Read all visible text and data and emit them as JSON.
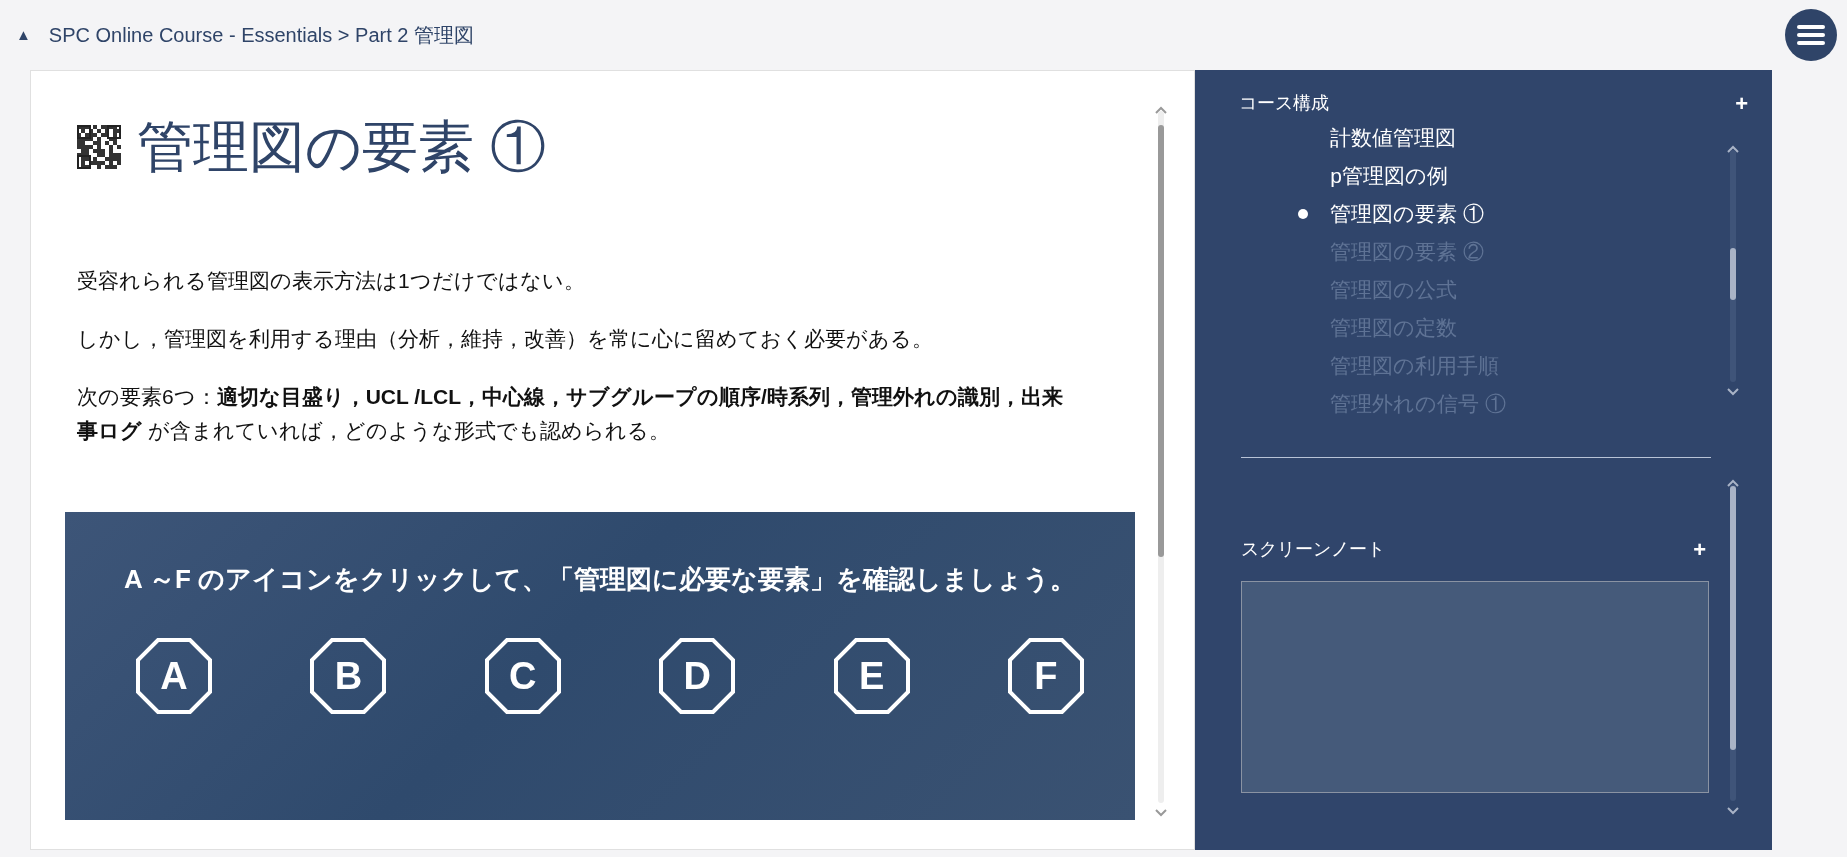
{
  "breadcrumb": {
    "toggle": "▲",
    "path": "SPC Online Course - Essentials > Part 2 管理図"
  },
  "page": {
    "title": "管理図の要素 ①",
    "paragraphs": [
      "受容れられる管理図の表示方法は1つだけではない。",
      "しかし，管理図を利用する理由（分析，維持，改善）を常に心に留めておく必要がある。",
      "次の要素6つ：**適切な目盛り，UCL /LCL，中心線，サブグループの順序/時系列，管理外れの識別，出来事ログ** が含まれていれば，どのような形式でも認められる。"
    ],
    "banner": {
      "instruction": "A ～F のアイコンをクリックして、「管理図に必要な要素」を確認しましょう。",
      "hotspots": [
        "A",
        "B",
        "C",
        "D",
        "E",
        "F"
      ]
    }
  },
  "sidebar": {
    "course_outline": {
      "title": "コース構成",
      "add": "+",
      "items": [
        {
          "label": "計数値管理図",
          "visited": true,
          "selected": false
        },
        {
          "label": "p管理図の例",
          "visited": true,
          "selected": false
        },
        {
          "label": "管理図の要素 ①",
          "visited": true,
          "selected": true
        },
        {
          "label": "管理図の要素 ②",
          "visited": false,
          "selected": false
        },
        {
          "label": "管理図の公式",
          "visited": false,
          "selected": false
        },
        {
          "label": "管理図の定数",
          "visited": false,
          "selected": false
        },
        {
          "label": "管理図の利用手順",
          "visited": false,
          "selected": false
        },
        {
          "label": "管理外れの信号 ①",
          "visited": false,
          "selected": false
        }
      ]
    },
    "screen_notes": {
      "title": "スクリーンノート",
      "add": "+"
    }
  }
}
